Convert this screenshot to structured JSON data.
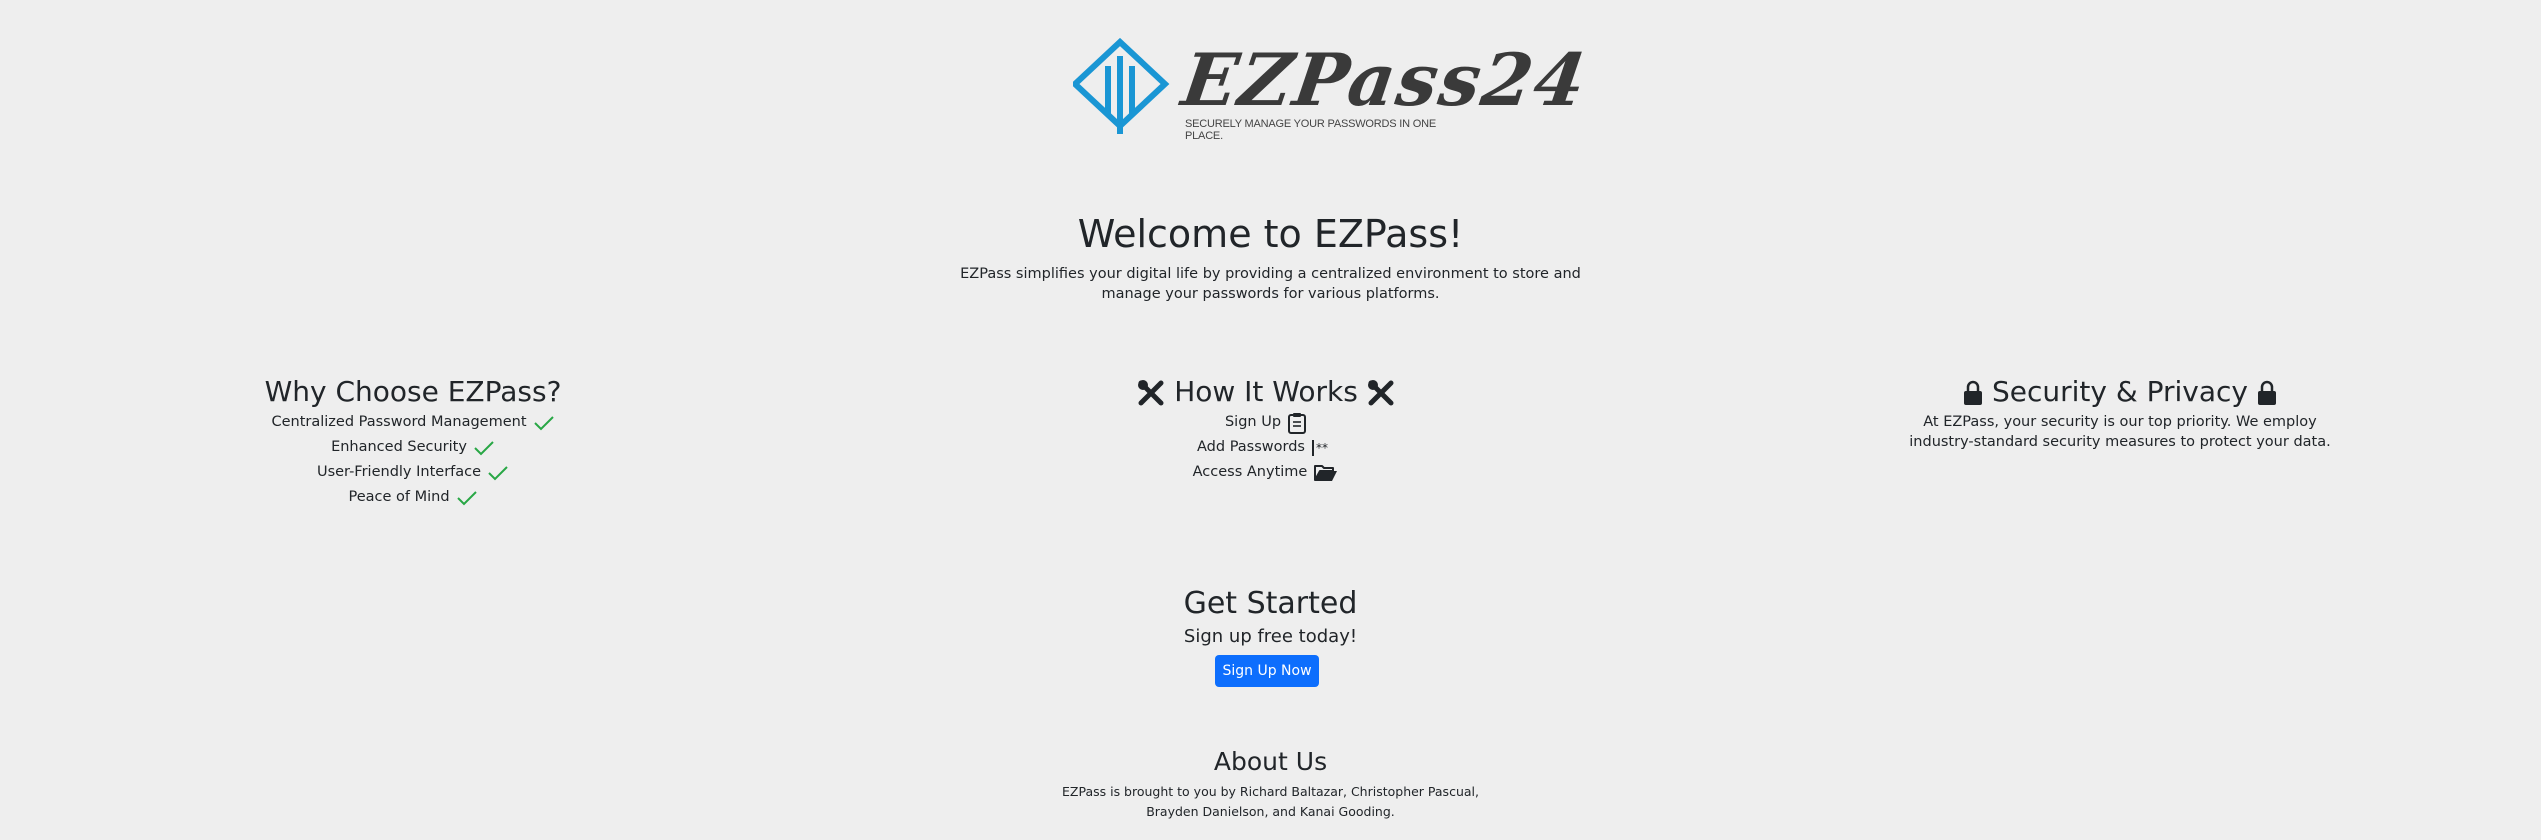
{
  "logo": {
    "wordmark": "EZPass24",
    "tagline": "SECURELY MANAGE YOUR PASSWORDS IN ONE PLACE.",
    "accent_color": "#1a96d4"
  },
  "hero": {
    "title": "Welcome to EZPass!",
    "intro_line1": "EZPass simplifies your digital life by providing a centralized environment to store and",
    "intro_line2": "manage your passwords for various platforms."
  },
  "why": {
    "title": "Why Choose EZPass?",
    "items": [
      {
        "label": "Centralized Password Management",
        "icon": "check-icon"
      },
      {
        "label": "Enhanced Security",
        "icon": "check-icon"
      },
      {
        "label": "User-Friendly Interface",
        "icon": "check-icon"
      },
      {
        "label": "Peace of Mind",
        "icon": "check-icon"
      }
    ],
    "check_color": "#28a745"
  },
  "how": {
    "title": "How It Works",
    "title_icon": "tools-icon",
    "items": [
      {
        "label": "Sign Up",
        "icon": "clipboard-icon"
      },
      {
        "label": "Add Passwords",
        "icon": "password-icon"
      },
      {
        "label": "Access Anytime",
        "icon": "folder-open-icon"
      }
    ]
  },
  "security": {
    "title": "Security & Privacy",
    "title_icon": "lock-icon",
    "text_line1": "At EZPass, your security is our top priority. We employ",
    "text_line2": "industry-standard security measures to protect your data."
  },
  "get_started": {
    "title": "Get Started",
    "subtitle": "Sign up free today!",
    "button_label": "Sign Up Now",
    "button_color": "#0d6efd"
  },
  "about": {
    "title": "About Us",
    "text_line1": "EZPass is brought to you by Richard Baltazar, Christopher Pascual,",
    "text_line2": "Brayden Danielson, and Kanai Gooding."
  }
}
